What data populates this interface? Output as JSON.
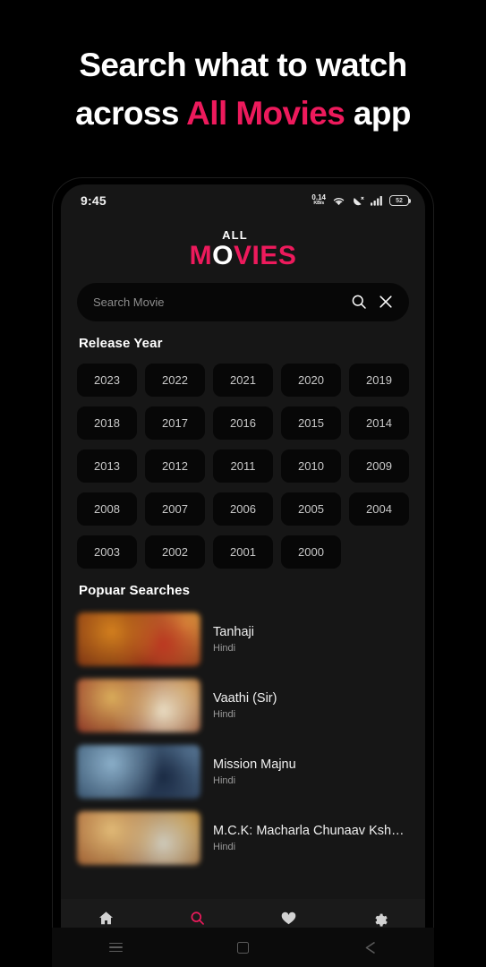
{
  "headline": {
    "line1": "Search what to watch",
    "line2_pre": "across ",
    "line2_accent": "All Movies",
    "line2_post": " app",
    "accent_color": "#ED1A5C"
  },
  "statusbar": {
    "time": "9:45",
    "net_speed_value": "0.14",
    "net_speed_unit": "KB/s",
    "wifi_icon": "wifi-icon",
    "vibrate_icon": "vibrate-icon",
    "signal_icon": "signal-bars-icon",
    "battery_level": "52"
  },
  "logo": {
    "top": "ALL",
    "bottom_a": "M",
    "bottom_o": "O",
    "bottom_b": "VIES"
  },
  "search": {
    "placeholder": "Search Movie",
    "value": "",
    "search_icon": "search-icon",
    "clear_icon": "close-icon"
  },
  "release_year": {
    "title": "Release Year",
    "years": [
      "2023",
      "2022",
      "2021",
      "2020",
      "2019",
      "2018",
      "2017",
      "2016",
      "2015",
      "2014",
      "2013",
      "2012",
      "2011",
      "2010",
      "2009",
      "2008",
      "2007",
      "2006",
      "2005",
      "2004",
      "2003",
      "2002",
      "2001",
      "2000"
    ]
  },
  "popular": {
    "title": "Popuar Searches",
    "items": [
      {
        "title": "Tanhaji",
        "language": "Hindi",
        "thumb_colors": [
          "#8a3a14",
          "#d9841f",
          "#c23a22",
          "#f0b84a",
          "#5a1d0d"
        ]
      },
      {
        "title": "Vaathi (Sir)",
        "language": "Hindi",
        "thumb_colors": [
          "#9c3b2a",
          "#e2b35e",
          "#f0e3c8",
          "#c98a3c",
          "#6b2418"
        ]
      },
      {
        "title": "Mission Majnu",
        "language": "Hindi",
        "thumb_colors": [
          "#3d5d79",
          "#8fb4cf",
          "#1b2b45",
          "#6e93b4",
          "#2a3c56"
        ]
      },
      {
        "title": "M.C.K: Macharla Chunaav Ksh…",
        "language": "Hindi",
        "thumb_colors": [
          "#b06a3a",
          "#e8c07a",
          "#d4d0c0",
          "#c8902f",
          "#7a4520"
        ]
      }
    ]
  },
  "bottom_nav": {
    "items": [
      {
        "label": "Home",
        "icon": "home-icon",
        "active": false
      },
      {
        "label": "Search",
        "icon": "search-icon",
        "active": true
      },
      {
        "label": "Fevourite",
        "icon": "heart-icon",
        "active": false
      },
      {
        "label": "Setting",
        "icon": "gear-icon",
        "active": false
      }
    ],
    "active_color": "#ED1A5C"
  },
  "system_bar": {
    "recents_icon": "recents-icon",
    "home_icon": "home-square-icon",
    "back_icon": "back-triangle-icon"
  }
}
